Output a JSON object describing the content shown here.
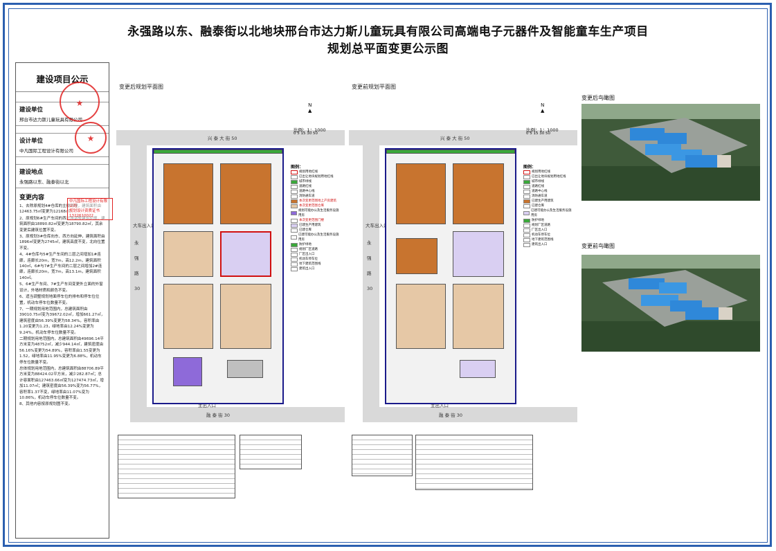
{
  "title_line1": "永强路以东、融泰街以北地块邢台市达力斯儿童玩具有限公司高端电子元器件及智能童车生产项目",
  "title_line2": "规划总平面变更公示图",
  "panel": {
    "heading": "建设项目公示",
    "fields": [
      {
        "label": "建设单位",
        "value": "邢台市达力斯儿童玩具有限公司"
      },
      {
        "label": "设计单位",
        "value": "中凡国际工程设计有限公司"
      },
      {
        "label": "建设地点",
        "value": "永强路以东、融泰街以北"
      }
    ],
    "changes_heading": "变更内容",
    "changes": [
      "1、去除原规划4#仓库的主楼两幢，建筑面积由12463.75㎡变更为12168㎡。",
      "2、原规划6#生产车间的西北角调整建筑轮廓，建筑面积由18890.82㎡变更为18790.82㎡，其余变更后建筑位置不变。",
      "3、原规划3#仓库向东、西方向延伸，建筑面积由1896㎡变更为2745㎡，建筑高度不变，北向位置不变。",
      "4、4#仓库与5#生产车间的二层之间增加1#连廊，连廊长20m，宽7m，高12.2m，建筑面积140㎡，6#与7#生产车间的二层之间增加2#连廊，连廊长20m，宽7m，高13.1m，建筑面积140㎡。",
      "5、6#生产车间、7#生产车间变更外立面的外窗设计，外墙材质和颜色不变。",
      "6、适当调整规划地面停车位的排布和停车位位置，机动车停车位数量不变。",
      "7、一期规划用地范围内，总建筑面积由39010.75㎡变为39672.02㎡，增加661.27㎡，建筑密度由56.39%变更为58.34%，容积率由1.20变更为1.23，绿地率由12.24%变更为9.24%，机动车停车位数量不变。",
      "二期规划用地范围内，总建筑面积由49696.14平方米变为48752㎡，减少944.14㎡，建筑密度由56.16%变更为54.89%，容积率由1.55变更为1.52，绿地率由11.95%变更为6.88%，机动车停车位数量不变。",
      "总体规划用地范围内，总建筑面积由88706.89平方米变为88424.02平方米，减少282.87㎡；总计容面积由127463.66㎡变为127474.73㎡，增加11.07㎡；建筑密度由56.39%变为56.77%，容积率1.37不变，绿地率由11.07%变为10.86%，机动车停车位数量不变。",
      "8、其他内容按原规划图不变。"
    ],
    "stamp_text": "中凡国际工程设计有限公司",
    "stamp_code": "规划设计资质证书 1322610022"
  },
  "plans": [
    {
      "label": "变更后规划平面图",
      "scale": "比例：1：1000",
      "road_top": "兴 泰 大 街 50",
      "road_bottom": "融 泰 街 30",
      "road_left": "永 强 路 30",
      "gate_left": "大车出入口",
      "gate_bottom": "主出入口",
      "legend_heading": "图例："
    },
    {
      "label": "变更前规划平面图",
      "scale": "比例：1：1000",
      "road_top": "兴 泰 大 街 50",
      "road_bottom": "融 泰 街 30",
      "road_left": "永 强 路 30",
      "gate_left": "大车出入口",
      "gate_bottom": "主出入口",
      "legend_heading": "图例："
    }
  ],
  "legend_items": [
    "规划用地红线",
    "已出让地块规划用地红线",
    "城市绿线",
    "道路红线",
    "道路中心线",
    "消防通车道",
    "本次变更范围地上产房建筑",
    "本次变更范围仓库",
    "规划可能办公及生活服务设施用房",
    "本次变更范围门楼",
    "已建生产用建筑",
    "已建仓库",
    "已建可能办公及生活服务设施用房",
    "防护绿地",
    "规划厂区道路",
    "厂区出入口",
    "机动车停车位",
    "地下建筑范围线",
    "建筑出入口"
  ],
  "aerial": [
    {
      "label": "变更后鸟瞰图"
    },
    {
      "label": "变更前鸟瞰图"
    }
  ],
  "north_label": "N",
  "scale_ticks": "0 5 15 30 50",
  "colors": {
    "border": "#2b5fb0",
    "red": "#d01010",
    "orange": "#c8742f",
    "purple": "#8e6ad9"
  }
}
